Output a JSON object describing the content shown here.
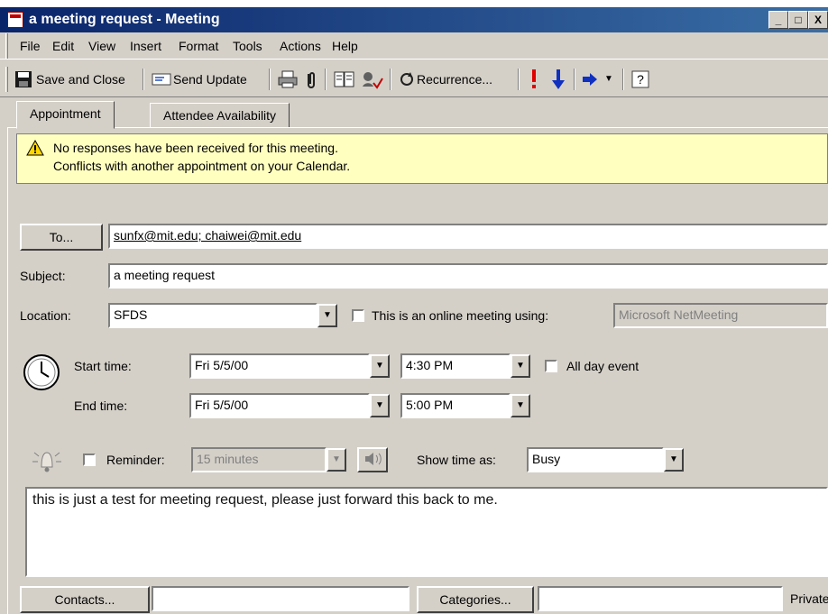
{
  "window": {
    "title": "a meeting request - Meeting",
    "min": "_",
    "max": "□",
    "close": "X"
  },
  "menu": [
    "File",
    "Edit",
    "View",
    "Insert",
    "Format",
    "Tools",
    "Actions",
    "Help"
  ],
  "toolbar": {
    "save_close": "Save and Close",
    "send_update": "Send Update",
    "recurrence": "Recurrence..."
  },
  "tabs": [
    {
      "label": "Appointment"
    },
    {
      "label": "Attendee Availability"
    }
  ],
  "info": {
    "line1": "No responses have been received for this meeting.",
    "line2": "Conflicts with another appointment on your Calendar."
  },
  "form": {
    "to_button": "To...",
    "to_value": "sunfx@mit.edu; chaiwei@mit.edu",
    "subject_label": "Subject:",
    "subject_value": "a meeting request",
    "location_label": "Location:",
    "location_value": "SFDS",
    "online_label": "This is an online meeting using:",
    "online_value": "Microsoft NetMeeting",
    "start_label": "Start time:",
    "start_date": "Fri 5/5/00",
    "start_time": "4:30 PM",
    "allday_label": "All day event",
    "end_label": "End time:",
    "end_date": "Fri 5/5/00",
    "end_time": "5:00 PM",
    "reminder_label": "Reminder:",
    "reminder_value": "15 minutes",
    "showtime_label": "Show time as:",
    "showtime_value": "Busy",
    "body": "this is just a test for meeting request, please just forward this back to me.",
    "contacts_button": "Contacts...",
    "categories_button": "Categories...",
    "private_label": "Private"
  }
}
